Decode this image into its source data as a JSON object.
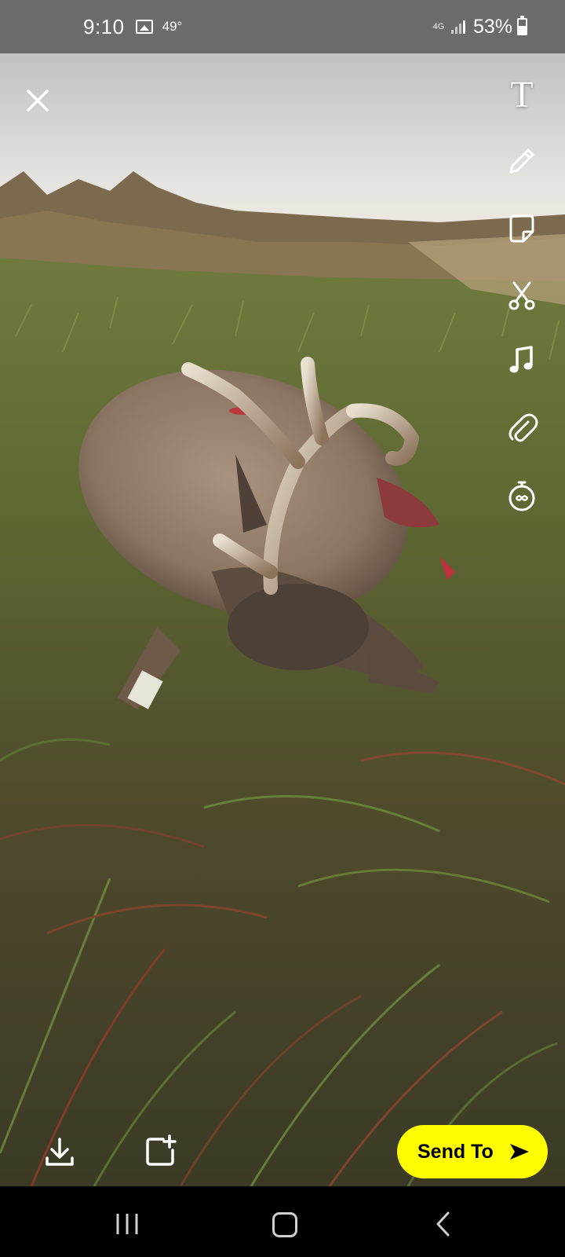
{
  "status_bar": {
    "time": "9:10",
    "temperature": "49°",
    "network": "4G",
    "battery_percent": "53%",
    "battery_level": 0.53,
    "icons": [
      "gallery-icon",
      "signal-icon",
      "battery-icon"
    ]
  },
  "editor": {
    "close_icon": "close-icon",
    "tools": [
      {
        "name": "text-tool",
        "icon": "T"
      },
      {
        "name": "draw-tool",
        "icon": "pencil-icon"
      },
      {
        "name": "sticker-tool",
        "icon": "sticker-icon"
      },
      {
        "name": "scissors-tool",
        "icon": "scissors-icon"
      },
      {
        "name": "music-tool",
        "icon": "music-note-icon"
      },
      {
        "name": "attach-link-tool",
        "icon": "paperclip-icon"
      },
      {
        "name": "timer-tool",
        "icon": "timer-icon"
      }
    ]
  },
  "bottom_bar": {
    "send_to_label": "Send To",
    "download_icon": "download-icon",
    "add_to_story_icon": "add-story-icon"
  },
  "nav_bar": {
    "icons": [
      "recents-icon",
      "home-icon",
      "back-icon"
    ]
  },
  "colors": {
    "snap_yellow": "#fffc00",
    "status_bar": "#6b6b6b"
  }
}
